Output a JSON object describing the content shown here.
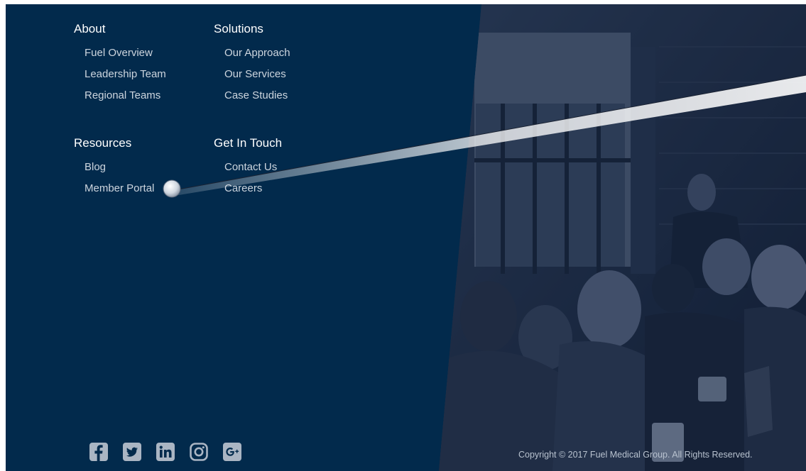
{
  "footer": {
    "columns": [
      {
        "heading": "About",
        "links": [
          "Fuel Overview",
          "Leadership Team",
          "Regional Teams"
        ]
      },
      {
        "heading": "Solutions",
        "links": [
          "Our Approach",
          "Our Services",
          "Case Studies"
        ]
      },
      {
        "heading": "Resources",
        "links": [
          "Blog",
          "Member Portal"
        ]
      },
      {
        "heading": "Get In Touch",
        "links": [
          "Contact Us",
          "Careers"
        ]
      }
    ],
    "social": [
      "facebook-icon",
      "twitter-icon",
      "linkedin-icon",
      "instagram-icon",
      "google-plus-icon"
    ],
    "copyright": "Copyright © 2017 Fuel Medical Group. All Rights Reserved."
  },
  "colors": {
    "background": "#022a4c",
    "link": "#cdd5de",
    "heading": "#ffffff"
  }
}
